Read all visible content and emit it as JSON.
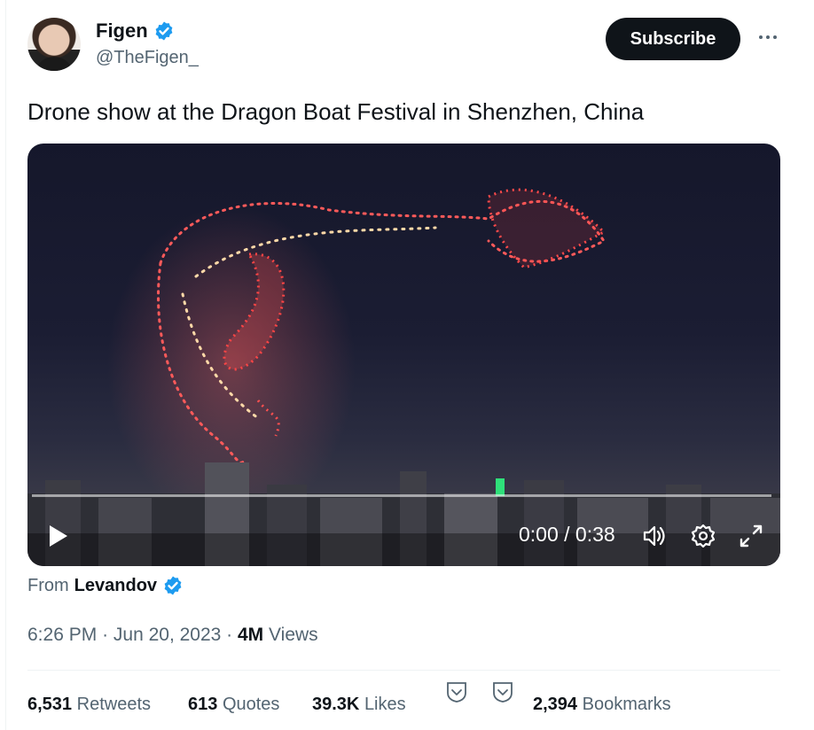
{
  "author": {
    "name": "Figen",
    "handle": "@TheFigen_"
  },
  "header": {
    "subscribe_label": "Subscribe"
  },
  "tweet": {
    "text": "Drone show at the Dragon Boat Festival in Shenzhen, China"
  },
  "video": {
    "time_display": "0:00 / 0:38",
    "progress": 0
  },
  "source": {
    "prefix": "From",
    "name": "Levandov"
  },
  "meta": {
    "time": "6:26 PM",
    "date": "Jun 20, 2023",
    "views_count": "4M",
    "views_label": "Views"
  },
  "stats": {
    "retweets_count": "6,531",
    "retweets_label": "Retweets",
    "quotes_count": "613",
    "quotes_label": "Quotes",
    "likes_count": "39.3K",
    "likes_label": "Likes",
    "bookmarks_count": "2,394",
    "bookmarks_label": "Bookmarks"
  },
  "colors": {
    "verified": "#1d9bf0",
    "text_primary": "#0f1419",
    "text_secondary": "#536471",
    "subscribe_bg": "#0f1419"
  },
  "icons": [
    "verified-badge-icon",
    "more-icon",
    "play-icon",
    "volume-icon",
    "settings-icon",
    "fullscreen-icon",
    "chevron-down-icon"
  ]
}
